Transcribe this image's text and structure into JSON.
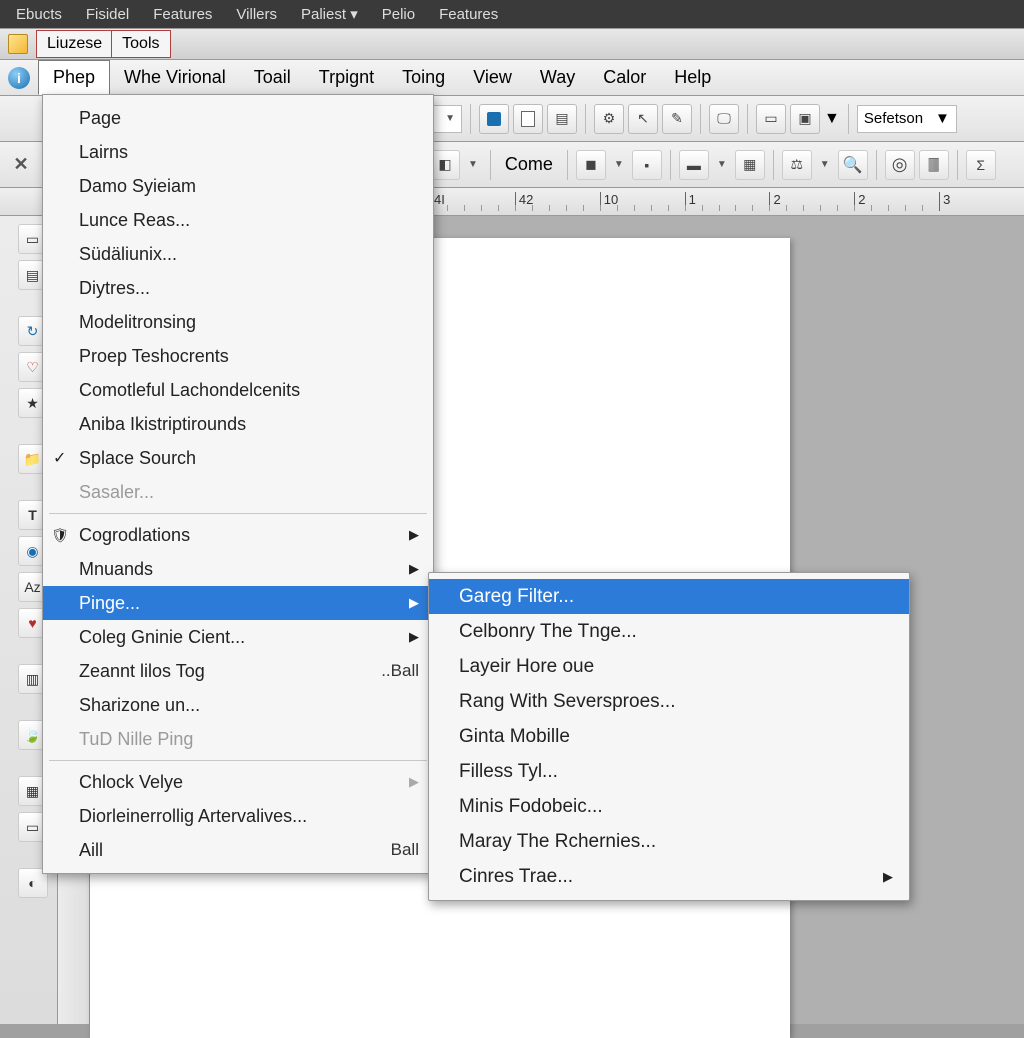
{
  "top_bar": {
    "items": [
      "Ebucts",
      "Fisidel",
      "Features",
      "Villers",
      "Paliest ▾",
      "Pelio",
      "Features"
    ]
  },
  "title_bar": {
    "tabs": [
      "Liuzese",
      "Tools"
    ]
  },
  "menu_bar": {
    "items": [
      "Phep",
      "Whe Virional",
      "Toail",
      "Trpignt",
      "Toing",
      "View",
      "Way",
      "Calor",
      "Help"
    ]
  },
  "toolbar1": {
    "dd1": "d:.",
    "combo1": "Sefetson"
  },
  "toolbar2": {
    "txt_btn": "Come"
  },
  "ruler": {
    "ticks": [
      "4I",
      "42",
      "10",
      "1",
      "2",
      "2",
      "3"
    ]
  },
  "menu": {
    "items": [
      {
        "label": "Page"
      },
      {
        "label": "Lairns"
      },
      {
        "label": "Damo Syieiam"
      },
      {
        "label": "Lunce Reas..."
      },
      {
        "label": "Südäliunix..."
      },
      {
        "label": "Diytres..."
      },
      {
        "label": "Modelitronsing"
      },
      {
        "label": "Proep Teshocrents"
      },
      {
        "label": "Comotleful Lachondelcenits"
      },
      {
        "label": "Aniba Ikistriptirounds"
      },
      {
        "label": "Splace Sourch",
        "checked": true
      },
      {
        "label": "Sasaler...",
        "disabled": true
      }
    ],
    "group2": [
      {
        "label": "Cogrodlations",
        "submenu": true,
        "icon": "shield"
      },
      {
        "label": "Mnuands",
        "submenu": true
      },
      {
        "label": "Pinge...",
        "submenu": true,
        "highlight": true
      },
      {
        "label": "Coleg Gninie Cient...",
        "submenu": true
      },
      {
        "label": "Zeannt lilos Tog",
        "accel": "..Ball"
      },
      {
        "label": "Sharizone un..."
      },
      {
        "label": "TuD Nille Ping",
        "disabled": true
      }
    ],
    "group3": [
      {
        "label": "Chlock Velye",
        "submenu": true,
        "disabled_arrow": true
      },
      {
        "label": "Diorleinerrollig Artervalives..."
      },
      {
        "label": "Aill",
        "accel": "Ball"
      }
    ]
  },
  "submenu": {
    "items": [
      {
        "label": "Gareg Filter...",
        "highlight": true
      },
      {
        "label": "Celbonry The Tnge..."
      },
      {
        "label": "Layeir Hore oue"
      },
      {
        "label": "Rang With Seversproes..."
      },
      {
        "label": "Ginta Mobille"
      },
      {
        "label": "Filless Tyl..."
      },
      {
        "label": "Minis Fodobeic..."
      },
      {
        "label": "Maray The Rchernies..."
      },
      {
        "label": "Cinres Trae...",
        "submenu": true
      }
    ]
  }
}
